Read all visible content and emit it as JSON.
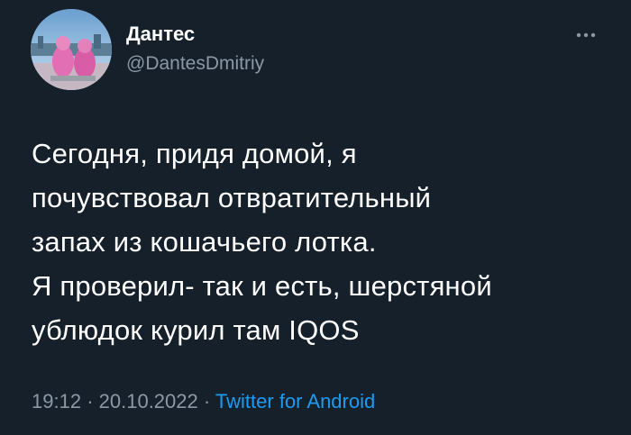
{
  "user": {
    "display_name": "Дантес",
    "handle": "@DantesDmitriy"
  },
  "tweet": {
    "text": "Сегодня, придя домой, я\nпочувствовал отвратительный\nзапах из кошачьего лотка.\nЯ проверил- так и есть, шерстяной\nублюдок курил там IQOS",
    "time": "19:12",
    "separator": "·",
    "date": "20.10.2022",
    "source": "Twitter for Android"
  },
  "icons": {
    "more": "more-options-icon"
  },
  "colors": {
    "background": "#15202b",
    "primary_text": "#ffffff",
    "secondary_text": "#8b98a5",
    "link": "#1d9bf0"
  }
}
